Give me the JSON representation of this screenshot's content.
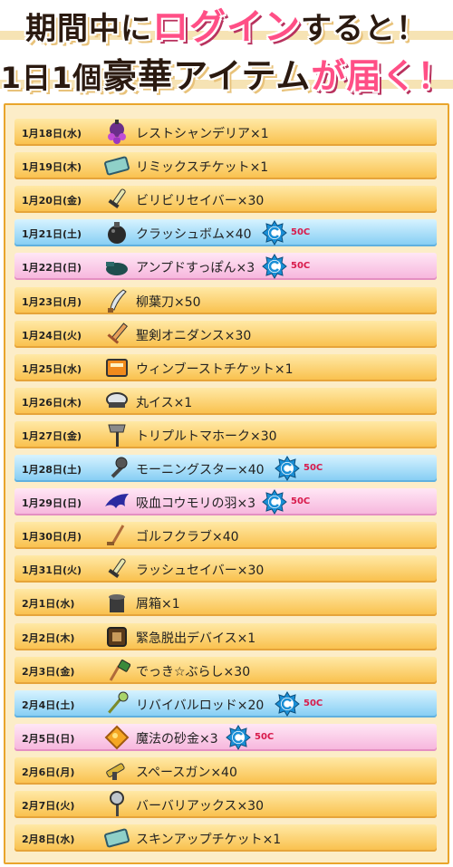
{
  "header": {
    "line1_pre": "期間中に",
    "line1_accent": "ログイン",
    "line1_post": "すると！",
    "line2_pre": "1日1個",
    "line2_mid": "豪華アイテム",
    "line2_post": "が届く！"
  },
  "rows": [
    {
      "date": "1月18日(水)",
      "item": "レストシャンデリア×1",
      "style": "normal",
      "icon": "chandelier-icon"
    },
    {
      "date": "1月19日(木)",
      "item": "リミックスチケット×1",
      "style": "normal",
      "icon": "ticket-icon"
    },
    {
      "date": "1月20日(金)",
      "item": "ビリビリセイバー×30",
      "style": "normal",
      "icon": "saber-icon"
    },
    {
      "date": "1月21日(土)",
      "item": "クラッシュボム×40",
      "style": "blue",
      "icon": "bomb-icon",
      "cost": "50C"
    },
    {
      "date": "1月22日(日)",
      "item": "アンプドすっぽん×3",
      "style": "pink",
      "icon": "plunger-icon",
      "cost": "50C"
    },
    {
      "date": "1月23日(月)",
      "item": "柳葉刀×50",
      "style": "normal",
      "icon": "blade-icon"
    },
    {
      "date": "1月24日(火)",
      "item": "聖剣オニダンス×30",
      "style": "normal",
      "icon": "sword-icon"
    },
    {
      "date": "1月25日(水)",
      "item": "ウィンブーストチケット×1",
      "style": "normal",
      "icon": "ticket-box-icon"
    },
    {
      "date": "1月26日(木)",
      "item": "丸イス×1",
      "style": "normal",
      "icon": "stool-icon"
    },
    {
      "date": "1月27日(金)",
      "item": "トリプルトマホーク×30",
      "style": "normal",
      "icon": "axe-icon"
    },
    {
      "date": "1月28日(土)",
      "item": "モーニングスター×40",
      "style": "blue",
      "icon": "mace-icon",
      "cost": "50C"
    },
    {
      "date": "1月29日(日)",
      "item": "吸血コウモリの羽×3",
      "style": "pink",
      "icon": "bat-wing-icon",
      "cost": "50C"
    },
    {
      "date": "1月30日(月)",
      "item": "ゴルフクラブ×40",
      "style": "normal",
      "icon": "golf-club-icon"
    },
    {
      "date": "1月31日(火)",
      "item": "ラッシュセイバー×30",
      "style": "normal",
      "icon": "saber-icon"
    },
    {
      "date": "2月1日(水)",
      "item": "屑箱×1",
      "style": "normal",
      "icon": "trash-can-icon"
    },
    {
      "date": "2月2日(木)",
      "item": "緊急脱出デバイス×1",
      "style": "normal",
      "icon": "device-icon"
    },
    {
      "date": "2月3日(金)",
      "item": "でっき☆ぶらし×30",
      "style": "normal",
      "icon": "brush-icon"
    },
    {
      "date": "2月4日(土)",
      "item": "リバイバルロッド×20",
      "style": "blue",
      "icon": "rod-icon",
      "cost": "50C"
    },
    {
      "date": "2月5日(日)",
      "item": "魔法の砂金×3",
      "style": "pink",
      "icon": "gold-dust-icon",
      "cost": "50C"
    },
    {
      "date": "2月6日(月)",
      "item": "スペースガン×40",
      "style": "normal",
      "icon": "gun-icon"
    },
    {
      "date": "2月7日(火)",
      "item": "バーバリアックス×30",
      "style": "normal",
      "icon": "battle-axe-icon"
    },
    {
      "date": "2月8日(水)",
      "item": "スキンアップチケット×1",
      "style": "normal",
      "icon": "ticket-icon"
    }
  ],
  "colors": {
    "accent": "#ff4f86",
    "coin": "#1a8fd6",
    "cost": "#d81a4b",
    "frame": "#e9a52c"
  }
}
